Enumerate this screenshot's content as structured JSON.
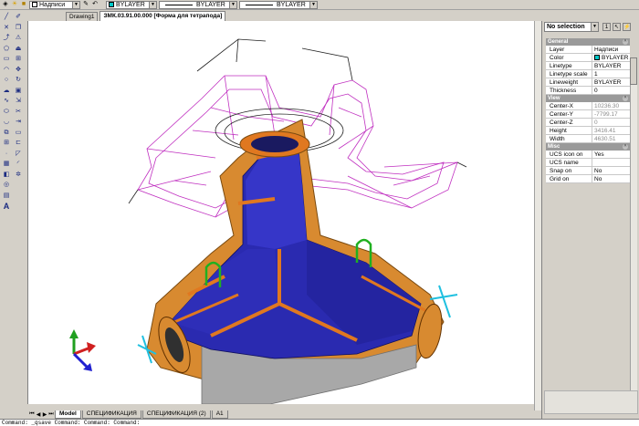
{
  "toolbar": {
    "layer_name": "Надписи",
    "color_value": "BYLAYER",
    "color_swatch": "#00c8c8",
    "linetype_value": "BYLAYER",
    "lineweight_value": "BYLAYER"
  },
  "doc_tabs": [
    {
      "label": "Drawing1",
      "active": false
    },
    {
      "label": "ЗМК.03.91.00.000 [Форма для тетрапода]",
      "active": true
    }
  ],
  "layout_tabs": [
    {
      "label": "Model",
      "active": true
    },
    {
      "label": "СПЕЦИФИКАЦИЯ",
      "active": false
    },
    {
      "label": "СПЕЦИФИКАЦИЯ (2)",
      "active": false
    },
    {
      "label": "A1",
      "active": false
    }
  ],
  "properties": {
    "selection": "No selection",
    "sections": [
      {
        "title": "General",
        "rows": [
          {
            "key": "Layer",
            "value": "Надписи"
          },
          {
            "key": "Color",
            "value": "BYLAYER",
            "swatch": "#00c8c8"
          },
          {
            "key": "Linetype",
            "value": "BYLAYER"
          },
          {
            "key": "Linetype scale",
            "value": "1"
          },
          {
            "key": "Lineweight",
            "value": "BYLAYER"
          },
          {
            "key": "Thickness",
            "value": "0"
          }
        ]
      },
      {
        "title": "View",
        "rows": [
          {
            "key": "Center-X",
            "value": "10236.30",
            "grey": true
          },
          {
            "key": "Center-Y",
            "value": "-7799.17",
            "grey": true
          },
          {
            "key": "Center-Z",
            "value": "0",
            "grey": true
          },
          {
            "key": "Height",
            "value": "3416.41",
            "grey": true
          },
          {
            "key": "Width",
            "value": "4630.51",
            "grey": true
          }
        ]
      },
      {
        "title": "Misc",
        "rows": [
          {
            "key": "UCS icon on",
            "value": "Yes"
          },
          {
            "key": "UCS name",
            "value": ""
          },
          {
            "key": "Snap on",
            "value": "No"
          },
          {
            "key": "Grid on",
            "value": "No"
          }
        ]
      }
    ]
  },
  "command_line": "Command: _qsave   Command:   Command:   Command:",
  "left_toolbar_icons": [
    "line-icon",
    "polyline-icon",
    "arc-icon",
    "circle-icon",
    "rectangle-icon",
    "hatch-icon",
    "text-icon"
  ]
}
